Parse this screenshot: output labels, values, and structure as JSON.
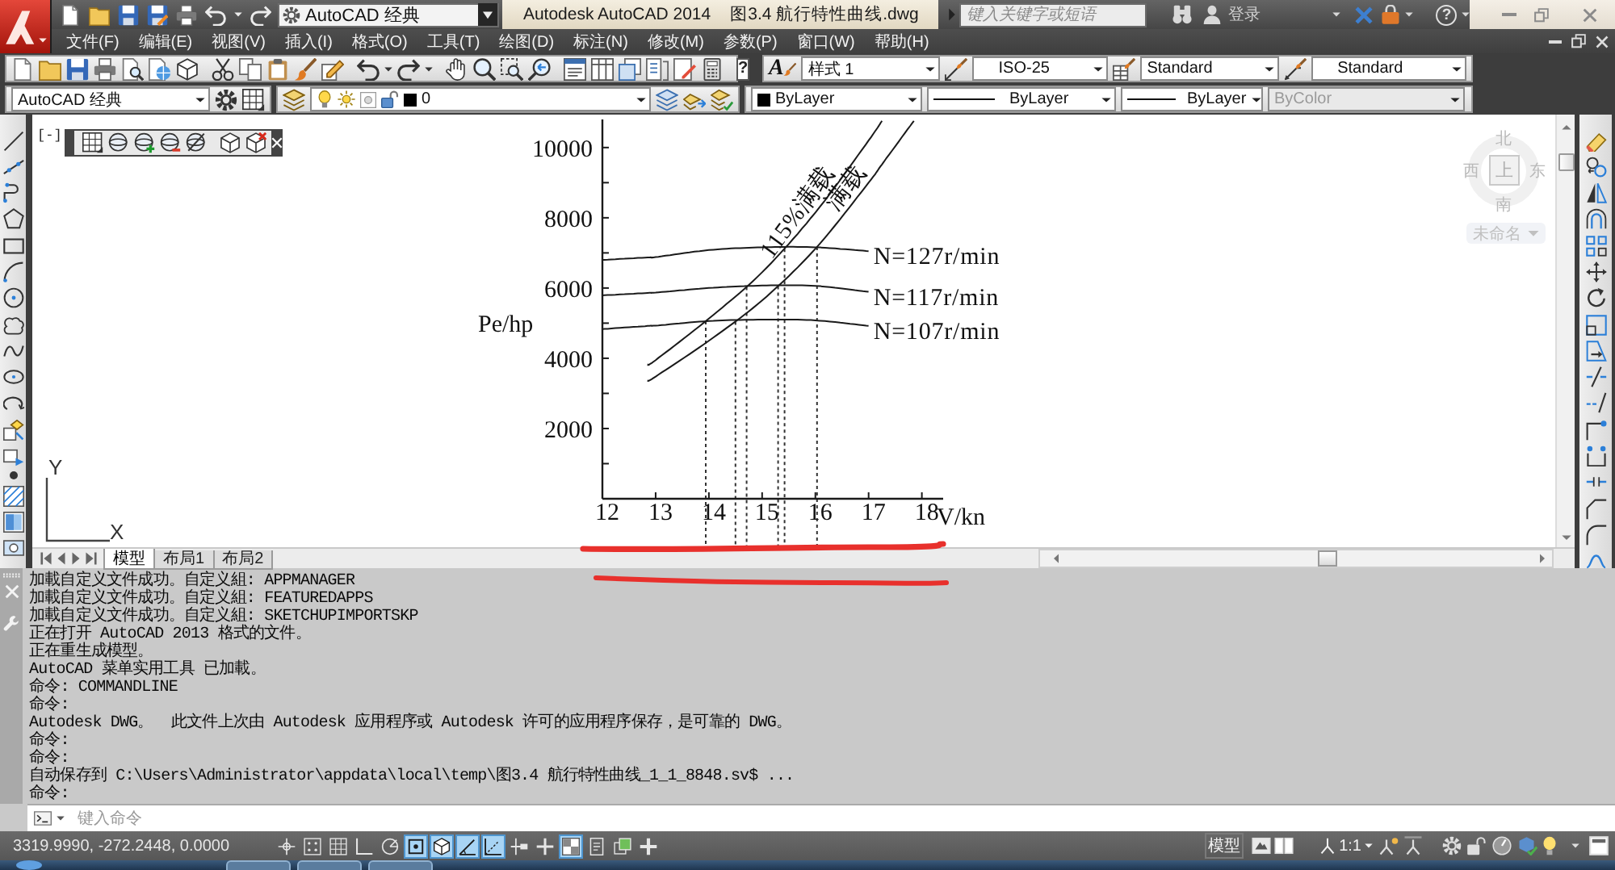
{
  "title_bar": {
    "workspace": "AutoCAD 经典",
    "app_title": "Autodesk AutoCAD 2014",
    "file_name": "图3.4 航行特性曲线.dwg",
    "search": {
      "placeholder": "键入关键字或短语"
    },
    "sign_in": "登录",
    "help": "?"
  },
  "menu_bar": {
    "items": [
      "文件(F)",
      "编辑(E)",
      "视图(V)",
      "插入(I)",
      "格式(O)",
      "工具(T)",
      "绘图(D)",
      "标注(N)",
      "修改(M)",
      "参数(P)",
      "窗口(W)",
      "帮助(H)"
    ]
  },
  "toolbars": {
    "help": "?",
    "text_style": {
      "icon_letter": "A",
      "value": "样式 1"
    },
    "dim_style": "ISO-25",
    "table_style": "Standard",
    "multileader_style": "Standard",
    "workspace": "AutoCAD 经典",
    "layer": "0",
    "color_control": "ByLayer",
    "linetype": "ByLayer",
    "lineweight": "ByLayer",
    "plot_style": {
      "value": "ByColor",
      "disabled": true
    }
  },
  "drawing": {
    "viewport_label": "[-]",
    "ucs": {
      "y_label": "Y",
      "x_label": "X"
    },
    "viewcube": {
      "north": "北",
      "west": "西",
      "face": "上",
      "east": "东",
      "south": "南",
      "ucs_menu": "未命名"
    },
    "chart_data": {
      "type": "line",
      "xlabel": "V/kn",
      "ylabel": "Pe/hp",
      "x": [
        12,
        12.85,
        13,
        14,
        15,
        16,
        17,
        17.25,
        17.85
      ],
      "series": [
        {
          "name": "N=127r/min",
          "values": [
            6800,
            6870,
            6880,
            7080,
            7160,
            7160,
            7050,
            null,
            null
          ]
        },
        {
          "name": "N=117r/min",
          "values": [
            5790,
            5860,
            5870,
            6000,
            6070,
            6060,
            5890,
            null,
            null
          ]
        },
        {
          "name": "N=107r/min",
          "values": [
            4830,
            4920,
            4930,
            5060,
            5100,
            5080,
            4920,
            null,
            null
          ]
        },
        {
          "name": "115%满载",
          "values": [
            null,
            3820,
            3950,
            5130,
            6450,
            8150,
            10200,
            10760,
            null
          ]
        },
        {
          "name": "满载",
          "values": [
            null,
            3360,
            3480,
            4500,
            5650,
            7120,
            9000,
            9520,
            10760
          ]
        }
      ],
      "xlim": [
        12,
        18.4
      ],
      "ylim": [
        0,
        10800
      ],
      "xticks": [
        12,
        13,
        14,
        15,
        16,
        17,
        18
      ],
      "yticks": [
        2000,
        4000,
        6000,
        8000,
        10000
      ],
      "ref_lines": [
        {
          "axis": "x",
          "value": 13.94
        },
        {
          "axis": "x",
          "value": 14.5
        },
        {
          "axis": "x",
          "value": 14.71
        },
        {
          "axis": "x",
          "value": 15.3
        },
        {
          "axis": "x",
          "value": 15.42
        },
        {
          "axis": "x",
          "value": 16.03
        }
      ]
    }
  },
  "layout_tabs": [
    {
      "label": "模型",
      "selected": true
    },
    {
      "label": "布局1",
      "selected": false
    },
    {
      "label": "布局2",
      "selected": false
    }
  ],
  "command_history": [
    "加載自定义文件成功。自定义組: APPMANAGER",
    "加載自定义文件成功。自定义組: FEATUREDAPPS",
    "加載自定义文件成功。自定义組: SKETCHUPIMPORTSKP",
    "正在打开 AutoCAD 2013 格式的文件。",
    "正在重生成模型。",
    "AutoCAD 菜单实用工具 已加載。",
    "命令: COMMANDLINE",
    "命令:",
    "Autodesk DWG。  此文件上次由 Autodesk 应用程序或 Autodesk 许可的应用程序保存，是可靠的 DWG。",
    "命令:",
    "命令:",
    "自动保存到 C:\\Users\\Administrator\\appdata\\local\\temp\\图3.4 航行特性曲线_1_1_8848.sv$ ...",
    "命令:"
  ],
  "command_line": {
    "placeholder": "键入命令"
  },
  "status_bar": {
    "coordinates": "3319.9990, -272.2448, 0.0000",
    "toggles": [
      {
        "on": false
      },
      {
        "on": false
      },
      {
        "on": false
      },
      {
        "on": false
      },
      {
        "on": false
      },
      {
        "on": true
      },
      {
        "on": true
      },
      {
        "on": true
      },
      {
        "on": true
      },
      {
        "on": false
      },
      {
        "on": false
      },
      {
        "on": true
      },
      {
        "on": false
      },
      {
        "on": false
      },
      {
        "on": false
      }
    ],
    "space": "模型",
    "annotation_scale": "1:1"
  }
}
